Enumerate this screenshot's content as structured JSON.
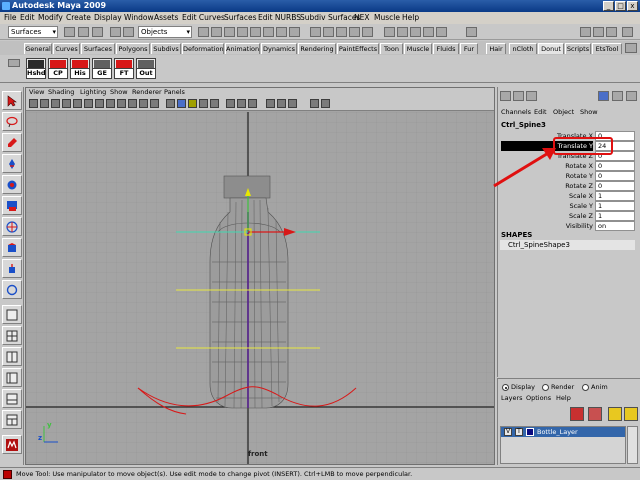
{
  "app": {
    "title": "Autodesk Maya 2009"
  },
  "window_buttons": [
    "_",
    "□",
    "x"
  ],
  "menu": [
    "File",
    "Edit",
    "Modify",
    "Create",
    "Display",
    "Window",
    "Assets",
    "Edit Curves",
    "Surfaces",
    "Edit NURBS",
    "Subdiv Surfaces",
    "NEX",
    "Muscle",
    "Help"
  ],
  "status": {
    "mode": "Surfaces",
    "selection_mask": "Objects"
  },
  "shelf_tabs": [
    "General",
    "Curves",
    "Surfaces",
    "Polygons",
    "Subdivs",
    "Deformation",
    "Animation",
    "Dynamics",
    "Rendering",
    "PaintEffects",
    "Toon",
    "Muscle",
    "Fluids",
    "Fur",
    "Hair",
    "nCloth",
    "Donut",
    "Scripts",
    "EtsTool"
  ],
  "active_shelf_tab": "Donut",
  "shelf_buttons": [
    {
      "label": "Hshd",
      "color": "#2a2a2a"
    },
    {
      "label": "CP",
      "color": "#d81818"
    },
    {
      "label": "His",
      "color": "#d81818"
    },
    {
      "label": "GE",
      "color": "#606060"
    },
    {
      "label": "FT",
      "color": "#d81818"
    },
    {
      "label": "Out",
      "color": "#606060"
    }
  ],
  "viewport": {
    "menu": [
      "View",
      "Shading",
      "Lighting",
      "Show",
      "Renderer",
      "Panels"
    ],
    "camera_label": "front",
    "axis_labels": {
      "z": "z",
      "y": "y"
    }
  },
  "channel_box": {
    "menu": [
      "Channels",
      "Edit",
      "Object",
      "Show"
    ],
    "object_name": "Ctrl_Spine3",
    "attributes": [
      {
        "name": "Translate X",
        "value": "0"
      },
      {
        "name": "Translate Y",
        "value": "24"
      },
      {
        "name": "Translate Z",
        "value": "0"
      },
      {
        "name": "Rotate X",
        "value": "0"
      },
      {
        "name": "Rotate Y",
        "value": "0"
      },
      {
        "name": "Rotate Z",
        "value": "0"
      },
      {
        "name": "Scale X",
        "value": "1"
      },
      {
        "name": "Scale Y",
        "value": "1"
      },
      {
        "name": "Scale Z",
        "value": "1"
      },
      {
        "name": "Visibility",
        "value": "on"
      }
    ],
    "selected_attribute": "Translate Y",
    "shapes_header": "SHAPES",
    "shape_name": "Ctrl_SpineShape3"
  },
  "layer_editor": {
    "modes": [
      {
        "label": "Display",
        "on": true
      },
      {
        "label": "Render",
        "on": false
      },
      {
        "label": "Anim",
        "on": false
      }
    ],
    "menu": [
      "Layers",
      "Options",
      "Help"
    ],
    "layers": [
      {
        "visible": "V",
        "template": "T",
        "name": "Bottle_Layer",
        "color": "#0a0a80"
      }
    ]
  },
  "help_line": "Move Tool: Use manipulator to move object(s). Use edit mode to change pivot (INSERT). Ctrl+LMB to move perpendicular.",
  "colors": {
    "annotation": "#e01010",
    "selection": "#000000",
    "layer_highlight": "#3366aa",
    "title_bar": "#0a3a86"
  }
}
